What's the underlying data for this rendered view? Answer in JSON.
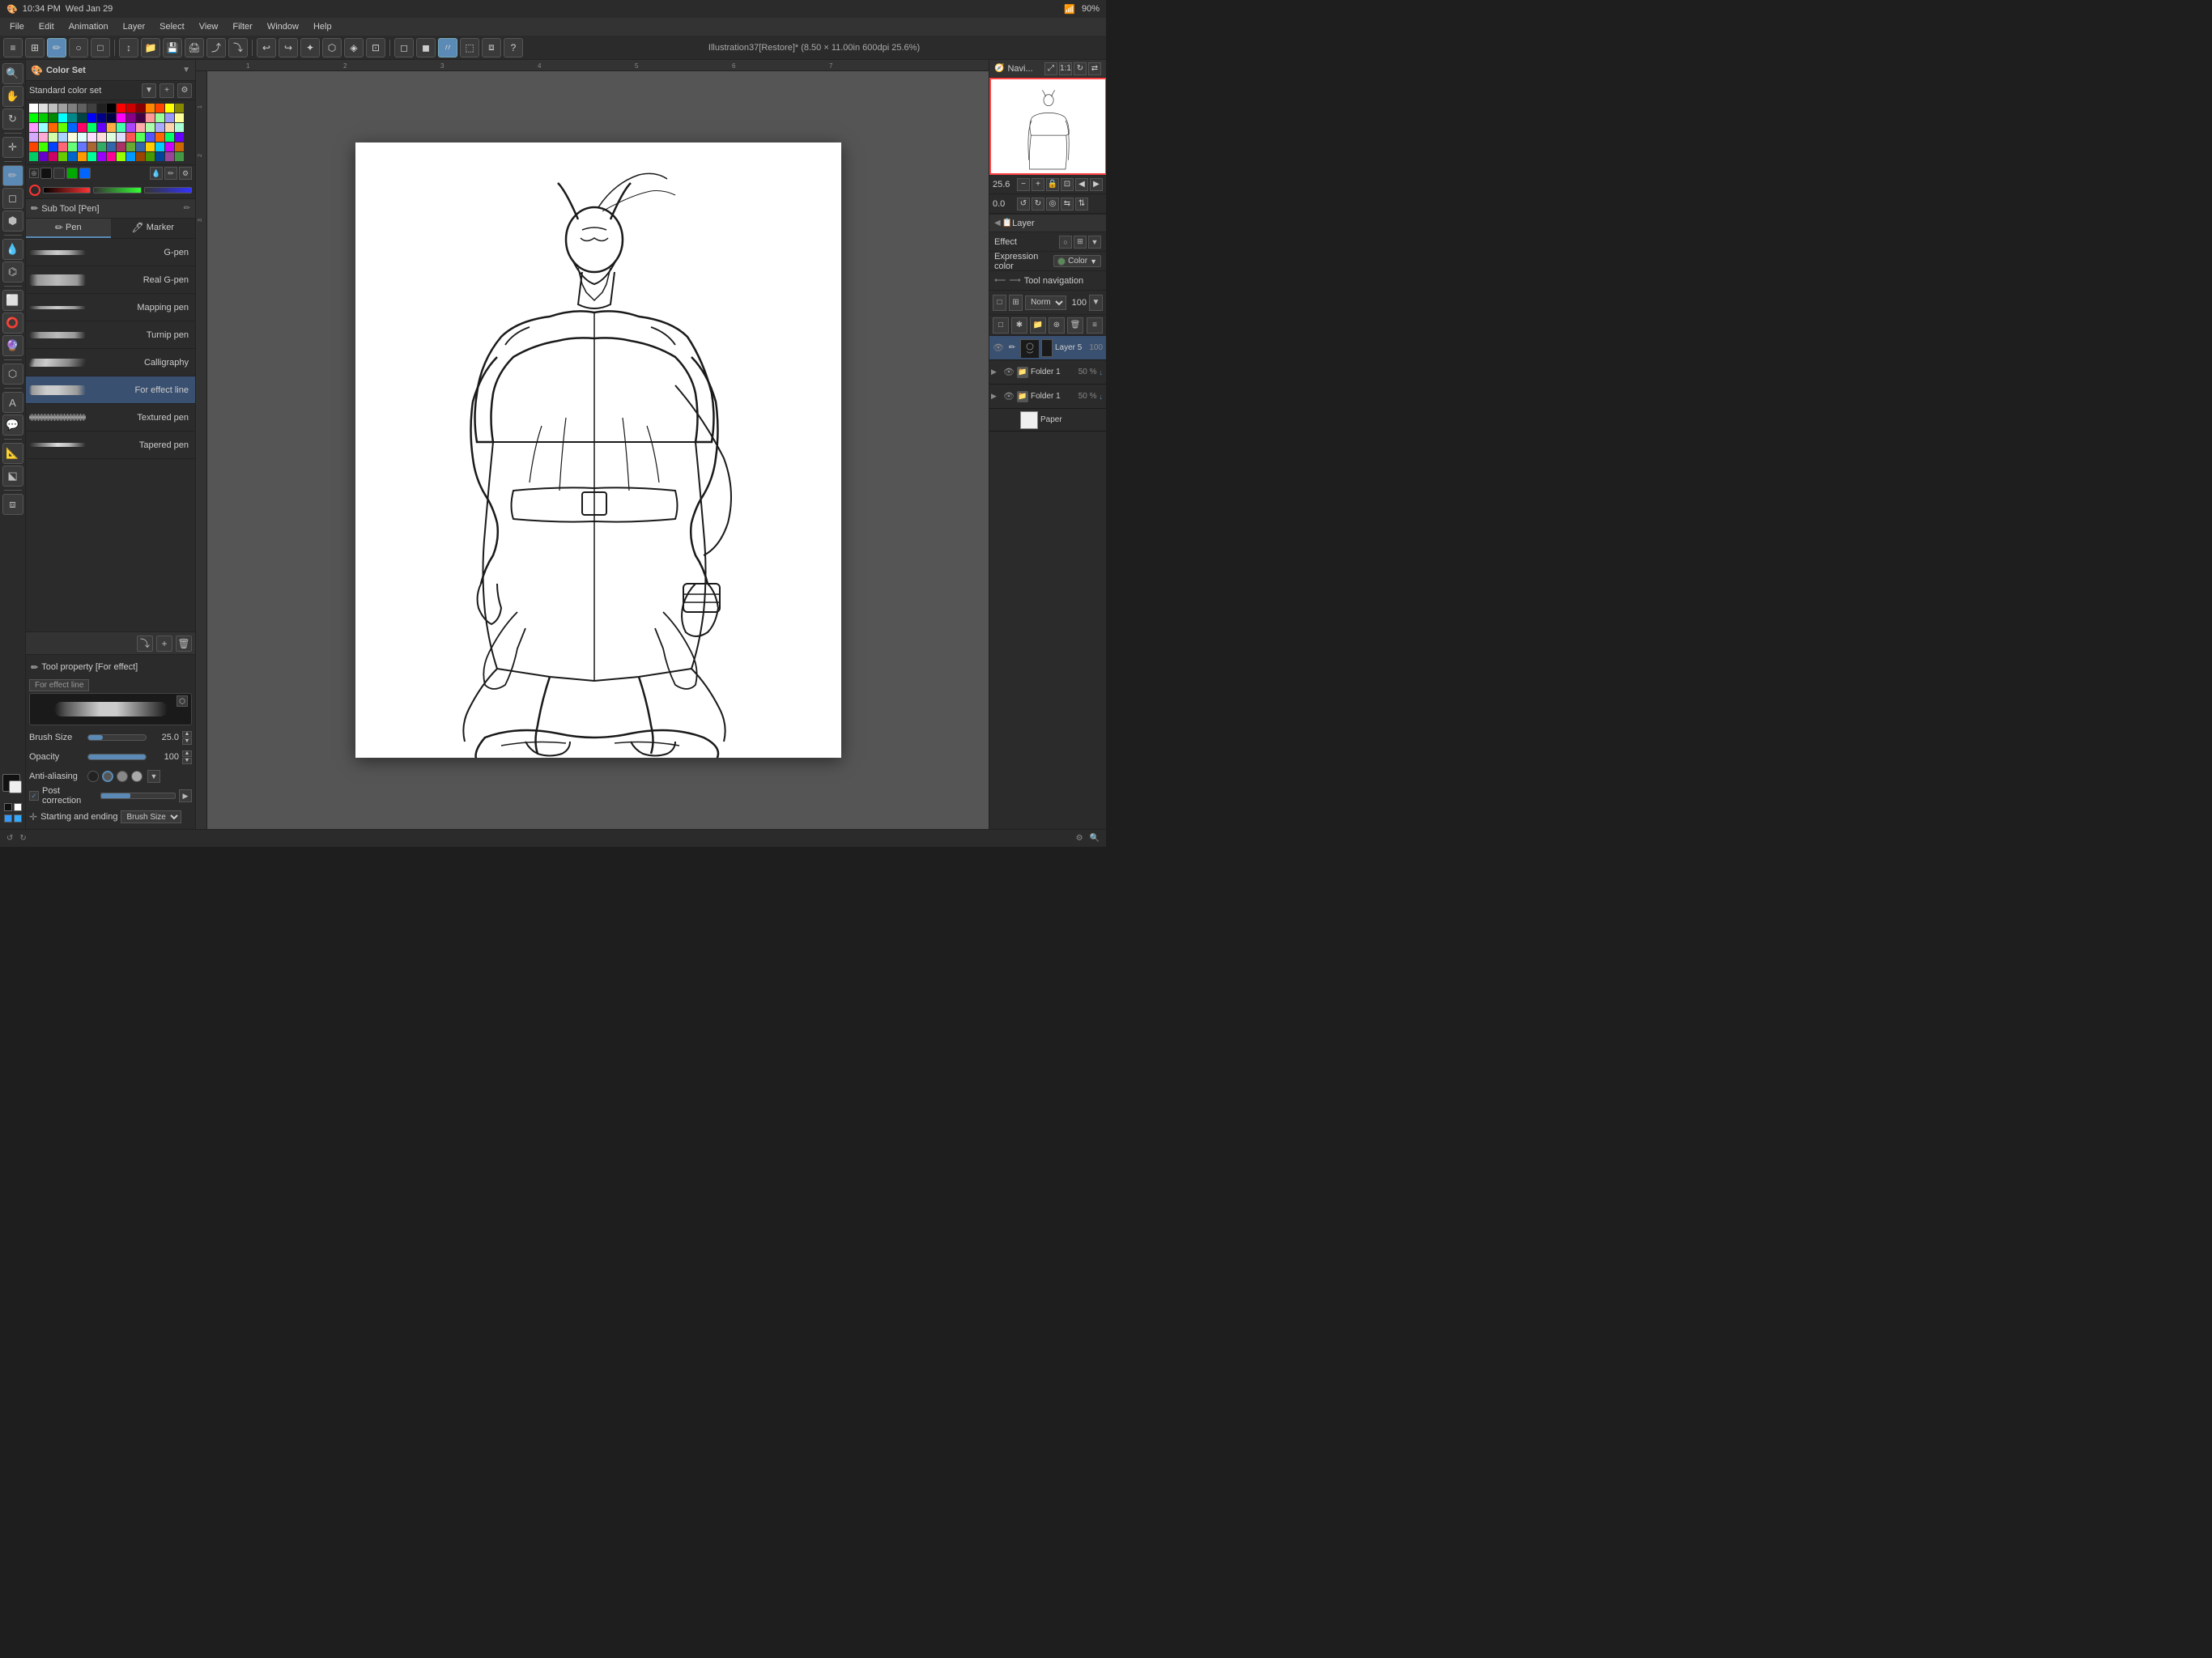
{
  "topbar": {
    "time": "10:34 PM",
    "date": "Wed Jan 29",
    "battery": "90%",
    "wifi": "WiFi"
  },
  "menubar": {
    "items": [
      "File",
      "Edit",
      "Animation",
      "Layer",
      "Select",
      "View",
      "Filter",
      "Window",
      "Help"
    ]
  },
  "toolbar": {
    "doc_title": "Illustration37[Restore]* (8.50 × 11.00in 600dpi 25.6%)"
  },
  "color_set": {
    "panel_title": "Color Set",
    "set_name": "Standard color set",
    "palette": [
      [
        "#ffffff",
        "#e0e0e0",
        "#c0c0c0",
        "#a0a0a0",
        "#808080",
        "#606060",
        "#404040",
        "#202020",
        "#000000",
        "#ff0000",
        "#800000",
        "#400000",
        "#ff8000",
        "#804000",
        "#ffff00",
        "#808000"
      ],
      [
        "#00ff00",
        "#008000",
        "#004000",
        "#00ffff",
        "#008080",
        "#004040",
        "#0000ff",
        "#000080",
        "#000040",
        "#ff00ff",
        "#800080",
        "#400040",
        "#ff8080",
        "#80ff80",
        "#8080ff",
        "#ffff80"
      ],
      [
        "#ff80ff",
        "#80ffff",
        "#ff4040",
        "#40ff40",
        "#4040ff",
        "#ff8040",
        "#40ff80",
        "#8040ff",
        "#ff4080",
        "#80ff40",
        "#4080ff",
        "#ffa0a0",
        "#a0ffa0",
        "#a0a0ff",
        "#ffd0a0",
        "#a0ffd0"
      ],
      [
        "#d0a0ff",
        "#ffa0d0",
        "#d0ffa0",
        "#a0d0ff",
        "#ffffe0",
        "#e0ffff",
        "#ffe0ff",
        "#ffe0e0",
        "#e0ffe0",
        "#e0e0ff",
        "#ff6060",
        "#60ff60",
        "#6060ff",
        "#ff6000",
        "#00ff60",
        "#6000ff"
      ],
      [
        "#ff0060",
        "#60ff00",
        "#0060ff",
        "#ff6060",
        "#60ff60",
        "#6060ff",
        "#c08040",
        "#408040",
        "#4040a0",
        "#a04080",
        "#80a040",
        "#4080a0",
        "#ffcc00",
        "#00ccff",
        "#cc00ff",
        "#cc6600"
      ],
      [
        "#00cc66",
        "#6600cc",
        "#cc0066",
        "#66cc00",
        "#0066cc",
        "#ff9900",
        "#00ff99",
        "#9900ff",
        "#ff0099",
        "#99ff00",
        "#0099ff",
        "#994400",
        "#449900",
        "#004499",
        "#994499",
        "#449944"
      ]
    ],
    "recent_colors": [
      "#111111",
      "#333333",
      "#555555",
      "#777777",
      "#999999",
      "#bbbbbb",
      "#dddddd",
      "#ffffff",
      "#ff4444",
      "#4444ff"
    ]
  },
  "subtool": {
    "panel_title": "Sub Tool [Pen]",
    "tabs": [
      "Pen",
      "Marker"
    ],
    "active_tab": "Pen",
    "brushes": [
      {
        "name": "G-pen",
        "active": false,
        "stroke": "normal"
      },
      {
        "name": "Real G-pen",
        "active": false,
        "stroke": "thick"
      },
      {
        "name": "Mapping pen",
        "active": false,
        "stroke": "thin"
      },
      {
        "name": "Turnip pen",
        "active": false,
        "stroke": "normal"
      },
      {
        "name": "Calligraphy",
        "active": false,
        "stroke": "callig"
      },
      {
        "name": "For effect line",
        "active": true,
        "stroke": "effect"
      },
      {
        "name": "Textured pen",
        "active": false,
        "stroke": "normal"
      },
      {
        "name": "Tapered pen",
        "active": false,
        "stroke": "thin"
      }
    ]
  },
  "tool_property": {
    "panel_title": "Tool property [For effect]",
    "brush_label": "For effect line",
    "brush_size_label": "Brush Size",
    "brush_size_value": "25.0",
    "opacity_label": "Opacity",
    "opacity_value": "100",
    "anti_alias_label": "Anti-aliasing",
    "post_correction_label": "Post correction",
    "post_correction_checked": true,
    "starting_ending_label": "Starting and ending",
    "starting_ending_option": "Brush Size"
  },
  "navigator": {
    "panel_title": "Navi...",
    "zoom": "25.6",
    "rotate": "0.0"
  },
  "layer_panel": {
    "panel_title": "Layer",
    "effect_label": "Effect",
    "expression_color_label": "Expression color",
    "color_label": "Color",
    "tool_navigation_label": "Tool navigation",
    "blend_mode": "Norm",
    "opacity": "100",
    "layers": [
      {
        "name": "Layer 5",
        "opacity": "100",
        "active": true,
        "type": "layer",
        "has_content": true
      },
      {
        "name": "Folder 1",
        "opacity": "50 %",
        "active": false,
        "type": "folder",
        "expanded": true
      },
      {
        "name": "Folder 1",
        "opacity": "50 %",
        "active": false,
        "type": "folder",
        "expanded": true
      }
    ],
    "paper_layer": {
      "name": "Paper"
    }
  }
}
